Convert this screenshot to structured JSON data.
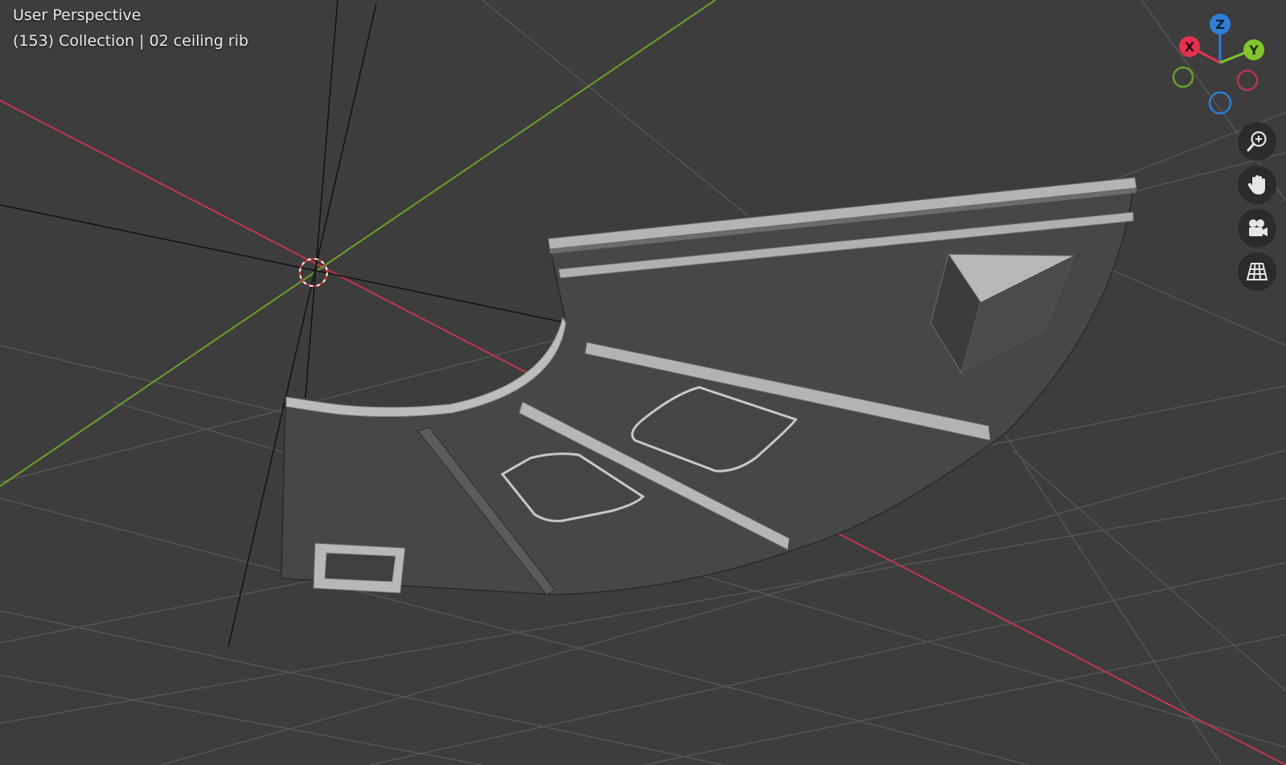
{
  "viewport": {
    "view_name": "User Perspective",
    "view_info": "(153) Collection | 02 ceiling rib"
  },
  "gizmo": {
    "x_label": "X",
    "y_label": "Y",
    "z_label": "Z",
    "x_color": "#e4314f",
    "y_color": "#82c52a",
    "z_color": "#2e7dd6"
  },
  "nav_buttons": [
    {
      "name": "zoom",
      "icon": "zoom-icon"
    },
    {
      "name": "pan",
      "icon": "hand-icon"
    },
    {
      "name": "camera",
      "icon": "camera-icon"
    },
    {
      "name": "ortho",
      "icon": "grid-icon"
    }
  ],
  "colors": {
    "background": "#3d3d3d",
    "grid": "#555555",
    "x_axis": "#c0384a",
    "y_axis": "#6ca12a",
    "mesh": "#454545",
    "mesh_highlight": "#bdbdbd"
  }
}
